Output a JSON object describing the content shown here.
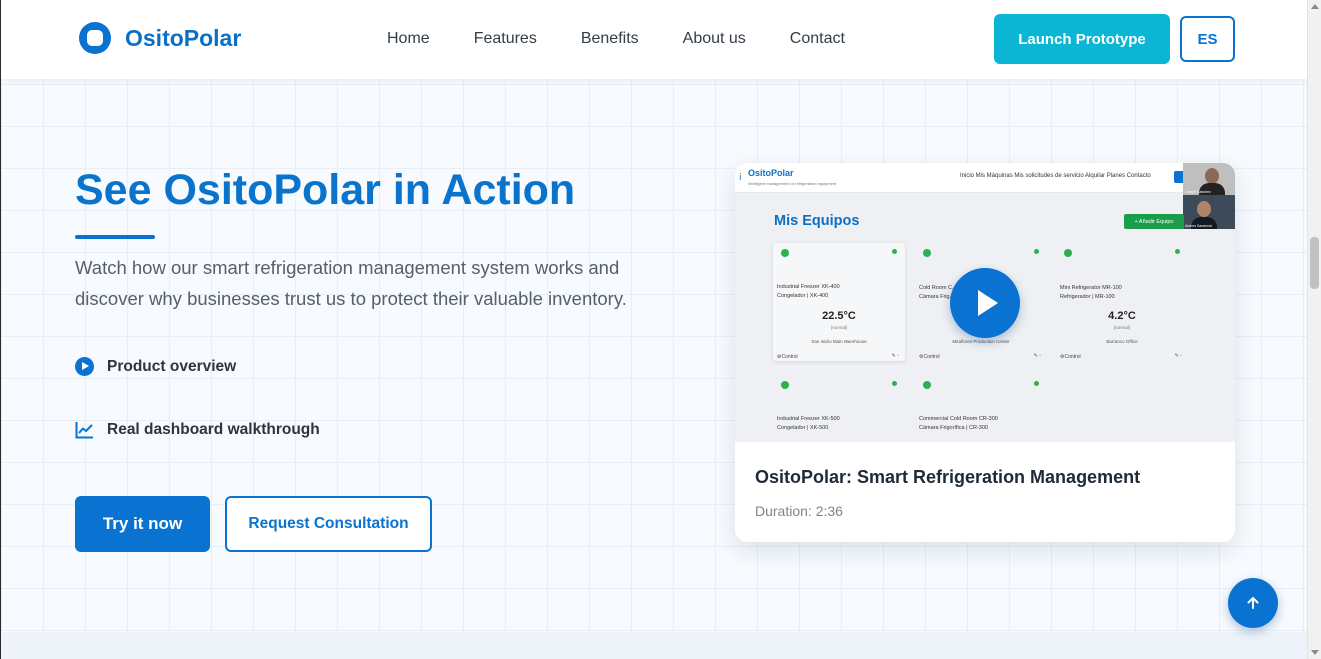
{
  "brand": {
    "name": "OsitoPolar"
  },
  "nav": {
    "links": [
      {
        "label": "Home"
      },
      {
        "label": "Features"
      },
      {
        "label": "Benefits"
      },
      {
        "label": "About us"
      },
      {
        "label": "Contact"
      }
    ],
    "launch_label": "Launch Prototype",
    "lang_label": "ES"
  },
  "hero": {
    "title": "See OsitoPolar in Action",
    "description": "Watch how our smart refrigeration management system works and discover why businesses trust us to protect their valuable inventory.",
    "features": [
      {
        "label": "Product overview",
        "icon": "play-circle-icon"
      },
      {
        "label": "Real dashboard walkthrough",
        "icon": "line-chart-icon"
      }
    ],
    "primary_button": "Try it now",
    "secondary_button": "Request Consultation"
  },
  "video": {
    "title": "OsitoPolar: Smart Refrigeration Management",
    "duration": "Duration: 2:36",
    "thumbnail": {
      "logo": "OsitoPolar",
      "logo_sub": "Intelligent management of refrigeration equipment",
      "menu": "Inicio   Mis Máquinas   Mis solicitudes de servicio   Alquilar   Planes   Contacto",
      "cam1_label": "Joseph Sanchez",
      "cam2_label": "Andres Sandoval",
      "heading": "Mis Equipos",
      "add_button": "+ Añadir Equipo",
      "equipment": [
        {
          "name": "Industrial Freezer XK-400",
          "sub": "Congelador | XK-400",
          "temp": "22.5°C",
          "status": "(normal)",
          "location": "San Isidro Main Warehouse",
          "control": "⚙Control"
        },
        {
          "name": "Cold Room C...",
          "sub": "Cámara Frig...",
          "temp": "",
          "status": "",
          "location": "Miraflores Production Center",
          "control": "⚙Control"
        },
        {
          "name": "Mini Refrigerator MR-100",
          "sub": "Refrigerador | MR-100",
          "temp": "4.2°C",
          "status": "(normal)",
          "location": "Barranco Office",
          "control": "⚙Control"
        },
        {
          "name": "Industrial Freezer XK-500",
          "sub": "Congelador | XK-500",
          "temp": "",
          "status": "",
          "location": "",
          "control": ""
        },
        {
          "name": "Commercial Cold Room CR-300",
          "sub": "Cámara Frigorífica | CR-300",
          "temp": "",
          "status": "",
          "location": "",
          "control": ""
        }
      ]
    }
  },
  "colors": {
    "primary": "#0a72d0",
    "accent": "#0bb6d4",
    "success": "#2bb150"
  }
}
